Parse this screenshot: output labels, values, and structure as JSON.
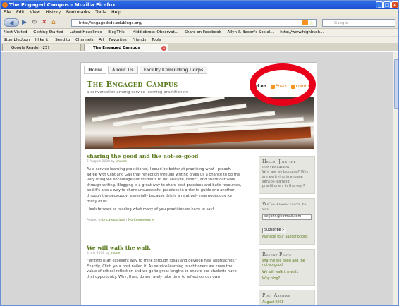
{
  "browser": {
    "title": "The Engaged Campus - Mozilla Firefox",
    "menu": [
      "File",
      "Edit",
      "View",
      "History",
      "Bookmarks",
      "Tools",
      "Help"
    ],
    "url": "http://engagedcdc.edublogs.org/",
    "search_placeholder": "Google",
    "bookmarks": [
      "Most Visited",
      "Getting Started",
      "Latest Headlines",
      "BlogThis!",
      "Middlebrow: Observat...",
      "Share on Facebook",
      "Allyn & Bacon's Social...",
      "http://www.highbush..."
    ],
    "toolbar2": [
      "StumbleUpon",
      "I like it!",
      "Send to",
      "Channels",
      "All",
      "Favorites",
      "Friends",
      "Tools"
    ],
    "tabs": [
      {
        "label": "Google Reader (25)"
      },
      {
        "label": "The Engaged Campus"
      }
    ]
  },
  "site": {
    "nav": [
      "Home",
      "About Us",
      "Faculty Consulting Corps"
    ],
    "title": "The Engaged Campus",
    "tagline": "a conversation among service-learning practitioners",
    "subscribe": {
      "prefix": "eed on",
      "posts": "Posts",
      "comments": "comm"
    }
  },
  "posts": [
    {
      "title": "sharing the good and the not-so-good",
      "date": "5 August 2008 by",
      "author": "jmadre",
      "paragraphs": [
        "As a service-learning practitioner, I could be better at practicing what I preach. I agree with Clint and Gail that reflection through writing gives us a chance to do the very thing we encourage our students to do: analyze, reflect, and share our work through writing. Blogging is a great way to share best practices and build resources, and it's also a way to share unsuccessful practices in order to guide one another through the pedagogy, especially because this is a relatively new pedagogy for many of us.",
        "I look forward to reading what many of you practitioners have to say!"
      ],
      "meta_prefix": "Posted in",
      "meta_category": "Uncategorized",
      "meta_comments": "No Comments »"
    },
    {
      "title": "We will walk the walk",
      "date": "4 July 2008 by",
      "author": "jmcnm",
      "paragraphs": [
        "\"Writing is an excellent way to think through ideas and develop new approaches.\" Exactly, Clint, your post nailed it. As service-learning practitioners we know the value of critical reflection and we go to great lengths to ensure our students have that opportunity. Why, then, do we rarely take time to reflect on our own"
      ]
    }
  ],
  "sidebar": {
    "join": {
      "title": "Hello. Join the conversation",
      "text": "Why are we blogging? Why are we trying to engage service-learning practitioners in this way?"
    },
    "email": {
      "title": "We'll email posts to you",
      "input": "ex.john@hotmail.com",
      "button": "Subscribe »",
      "link": "Manage Your Subscriptions"
    },
    "recent": {
      "title": "Recent Posts",
      "items": [
        "sharing the good and the not-so-good",
        "We will walk the walk",
        "Why blog?"
      ]
    },
    "archive": {
      "title": "Post Archive",
      "items": [
        "August 2008"
      ]
    }
  },
  "colors": {
    "accent": "#5b7a1e",
    "annotation": "#e8001a"
  }
}
